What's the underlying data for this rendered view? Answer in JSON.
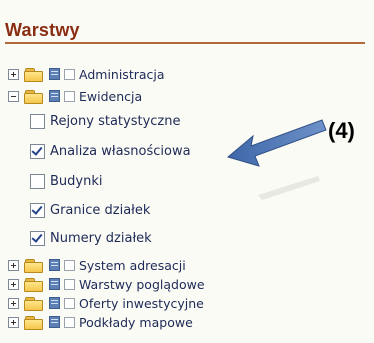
{
  "panel": {
    "title": "Warstwy"
  },
  "tree": {
    "top_groups": [
      {
        "label": "Administracja",
        "expanded": false
      },
      {
        "label": "Ewidencja",
        "expanded": true
      }
    ],
    "ewidencja_layers": [
      {
        "label": "Rejony statystyczne",
        "checked": false
      },
      {
        "label": "Analiza własnościowa",
        "checked": true
      },
      {
        "label": "Budynki",
        "checked": false
      },
      {
        "label": "Granice działek",
        "checked": true
      },
      {
        "label": "Numery działek",
        "checked": true
      }
    ],
    "bottom_groups": [
      {
        "label": "System adresacji",
        "expanded": false
      },
      {
        "label": "Warstwy poglądowe",
        "expanded": false
      },
      {
        "label": "Oferty inwestycyjne",
        "expanded": false
      },
      {
        "label": "Podkłady mapowe",
        "expanded": false
      }
    ]
  },
  "annotation": {
    "label": "(4)",
    "arrow_color": "#4f77b5"
  },
  "colors": {
    "title": "#8b2d12",
    "text": "#1e2a57",
    "background": "#fbfbf5"
  }
}
